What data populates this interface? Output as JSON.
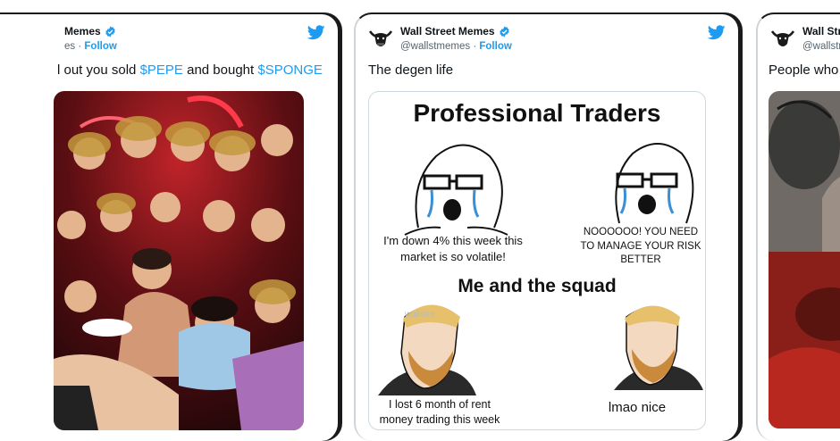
{
  "cards": [
    {
      "name": "Memes",
      "handle": "es",
      "follow": "Follow",
      "text_parts": [
        "l out you sold ",
        "$PEPE",
        " and bought ",
        "$SPONGE"
      ]
    },
    {
      "name": "Wall Street Memes",
      "handle": "@wallstmemes",
      "follow": "Follow",
      "text": "The degen life",
      "meme": {
        "title_top": "Professional Traders",
        "title_bottom": "Me and the squad",
        "cap_tl": "I'm down 4% this week this market is so volatile!",
        "cap_tr": "NOOOOOO! YOU NEED TO MANAGE YOUR RISK BETTER",
        "cap_bl": "I lost 6 month of rent money trading this week",
        "cap_br": "lmao nice",
        "watermark": "wallstre"
      }
    },
    {
      "name": "Wall Stre",
      "handle": "@wallstr",
      "text": "People who l"
    }
  ],
  "colors": {
    "link": "#1d9bf0",
    "muted": "#536471",
    "border": "#cfd9de",
    "verified": "#1d9bf0"
  },
  "icons": [
    "twitter-bird-icon",
    "verified-badge-icon",
    "bull-logo-avatar"
  ]
}
